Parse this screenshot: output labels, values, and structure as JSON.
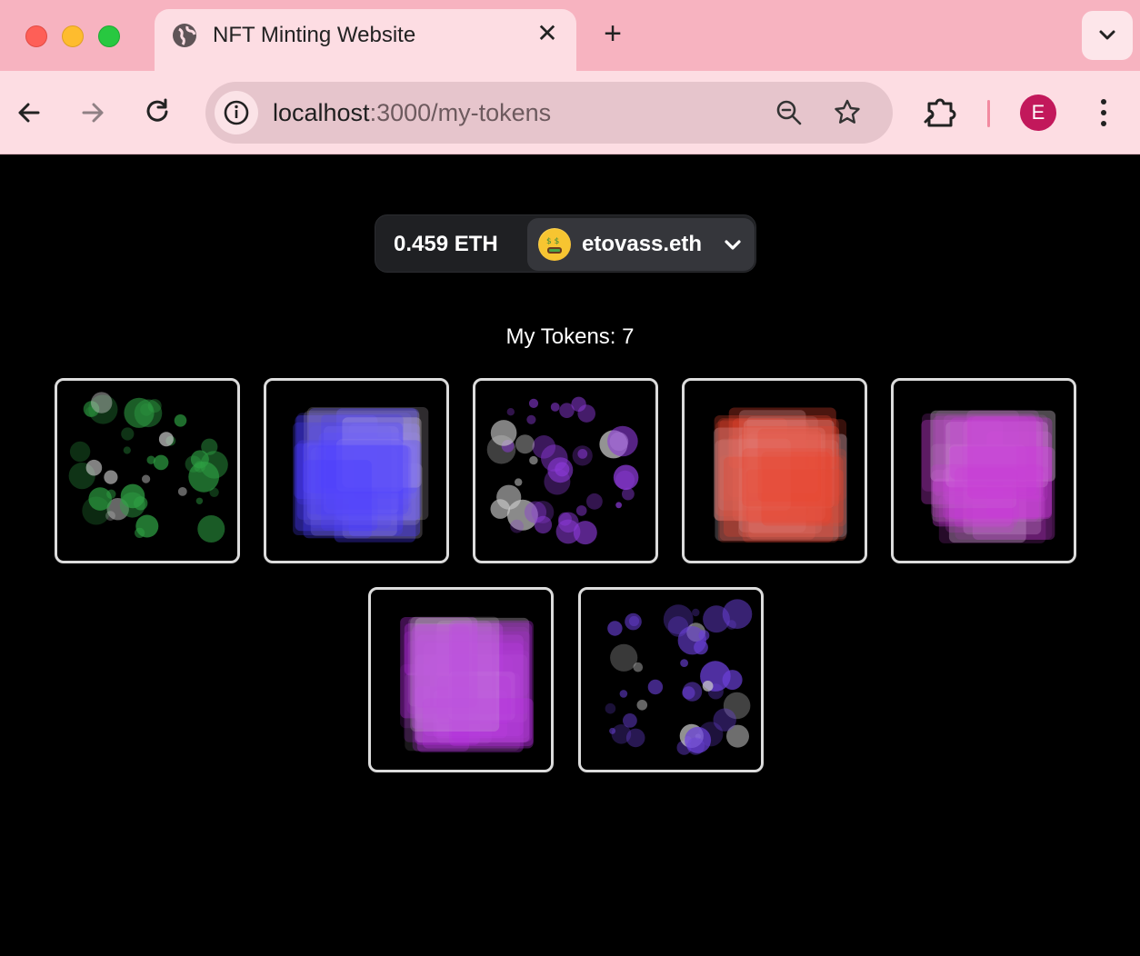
{
  "browser": {
    "tab_title": "NFT Minting Website",
    "tab_close_glyph": "✕",
    "new_tab_glyph": "+",
    "url_host": "localhost",
    "url_rest": ":3000/my-tokens",
    "profile_initial": "E",
    "icons": [
      "globe-icon",
      "back-arrow-icon",
      "forward-arrow-icon",
      "reload-icon",
      "site-info-icon",
      "zoom-icon",
      "bookmark-star-icon",
      "extensions-icon",
      "kebab-menu-icon",
      "chevron-down-icon"
    ]
  },
  "wallet": {
    "balance": "0.459 ETH",
    "ens_name": "etovass.eth",
    "avatar_emoji": "money-mouth-face",
    "accent": "#35363b"
  },
  "tokens": {
    "heading": "My Tokens: 7",
    "items": [
      {
        "style": "bubbles",
        "color": "#2ea043"
      },
      {
        "style": "squares",
        "color": "#4a3cff"
      },
      {
        "style": "bubbles",
        "color": "#8c3ad8"
      },
      {
        "style": "squares",
        "color": "#e8442e"
      },
      {
        "style": "squares",
        "color": "#c83ad8"
      },
      {
        "style": "squares",
        "color": "#b52ee0"
      },
      {
        "style": "bubbles",
        "color": "#6a40d8"
      }
    ]
  }
}
